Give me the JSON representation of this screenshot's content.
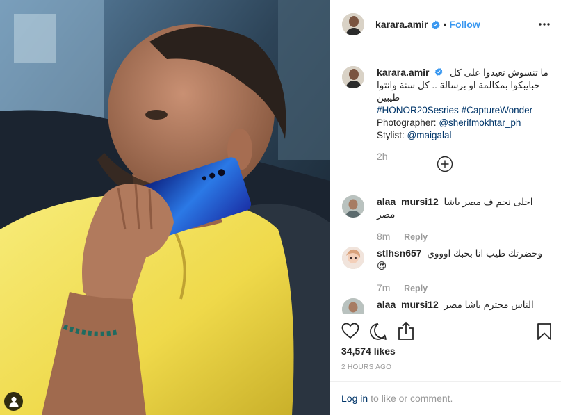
{
  "header": {
    "username": "karara.amir",
    "separator": "•",
    "follow_label": "Follow",
    "more_icon": "more-options-icon"
  },
  "caption": {
    "username": "karara.amir",
    "line1": "ما تنسوش تعيدوا على كل",
    "line2": "حبايبكوا بمكالمة او برسالة .. كل سنة وانتوا طيبين",
    "hashtag1": "#HONOR20Sesries",
    "hashtag2": "#CaptureWonder",
    "photographer_label": "Photographer:",
    "photographer_handle": "@sherifmokhtar_ph",
    "stylist_label": "Stylist:",
    "stylist_handle": "@maigalal",
    "time": "2h"
  },
  "comments": [
    {
      "username": "alaa_mursi12",
      "text": "احلى نجم ف مصر باشا مصر",
      "time": "8m",
      "reply_label": "Reply"
    },
    {
      "username": "stlhsn657",
      "text": "وحضرتك طيب انا بحبك اوووي😍",
      "time": "7m",
      "reply_label": "Reply"
    },
    {
      "username": "alaa_mursi12",
      "text": "الناس محترم باشا مصر",
      "time": "",
      "reply_label": ""
    }
  ],
  "actions": {
    "likes": "34,574 likes",
    "posted": "2 HOURS AGO",
    "icons": [
      "heart-icon",
      "comment-icon",
      "share-icon",
      "bookmark-icon"
    ]
  },
  "footer": {
    "login_label": "Log in",
    "login_suffix": "to like or comment."
  },
  "colors": {
    "link": "#3897f0",
    "hashtag": "#003569",
    "muted": "#999999",
    "verified": "#3897f0"
  }
}
